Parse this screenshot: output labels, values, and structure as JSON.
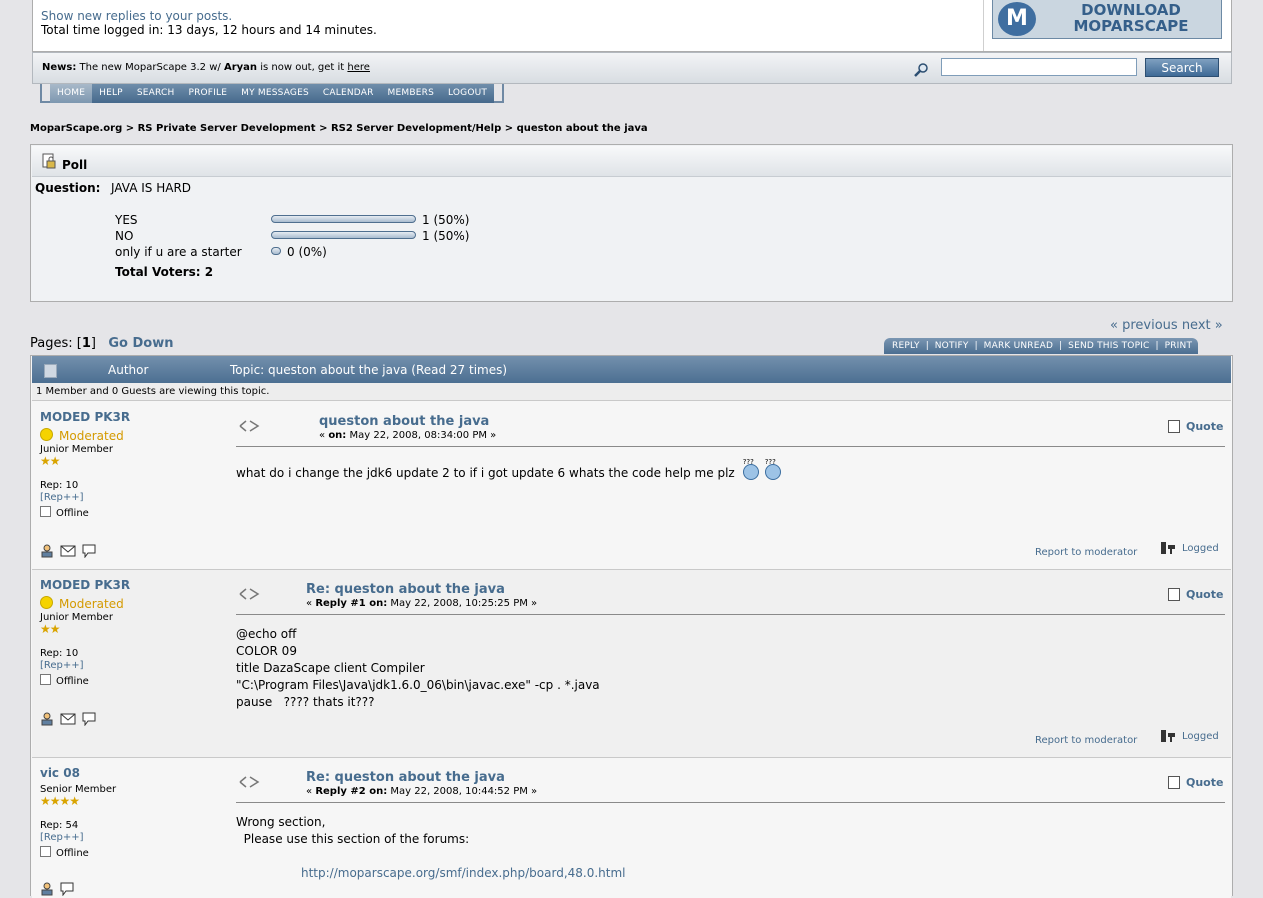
{
  "header": {
    "link_show_new_replies": "Show new replies to your posts.",
    "time_logged": "Total time logged in: 13 days, 12 hours and 14 minutes.",
    "banner_logo": "M",
    "banner_line1": "DOWNLOAD",
    "banner_line2": "MOPARSCAPE"
  },
  "news": {
    "label": "News:",
    "text_before": "The new MoparScape 3.2 w/",
    "bold": "Aryan",
    "text_after": "is now out, get it",
    "link": "here"
  },
  "search": {
    "value": "",
    "button": "Search"
  },
  "nav": [
    "HOME",
    "HELP",
    "SEARCH",
    "PROFILE",
    "MY MESSAGES",
    "CALENDAR",
    "MEMBERS",
    "LOGOUT"
  ],
  "breadcrumb": {
    "items": [
      "MoparScape.org",
      "RS Private Server Development",
      "RS2 Server Development/Help",
      "queston about the java"
    ],
    "sep": ">"
  },
  "poll": {
    "title": "Poll",
    "question_label": "Question:",
    "question": "JAVA IS HARD",
    "options": [
      {
        "label": "YES",
        "votes_text": "1 (50%)",
        "percent": 50
      },
      {
        "label": "NO",
        "votes_text": "1 (50%)",
        "percent": 50
      },
      {
        "label": "only if u are a starter",
        "votes_text": "0 (0%)",
        "percent": 0
      }
    ],
    "total": "Total Voters: 2"
  },
  "pagenav": {
    "prev": "« previous",
    "next": "next »"
  },
  "pages": {
    "label": "Pages: [",
    "current": "1",
    "close": "]",
    "go_down": "Go Down"
  },
  "topic_buttons": [
    "REPLY",
    "NOTIFY",
    "MARK UNREAD",
    "SEND THIS TOPIC",
    "PRINT"
  ],
  "topic": {
    "author_header": "Author",
    "title_header": "Topic: queston about the java  (Read 27 times)",
    "viewing": "1 Member and 0 Guests are viewing this topic."
  },
  "posts": [
    {
      "author": "MODED PK3R",
      "status": "Moderated",
      "rank": "Junior Member",
      "stars": "★★",
      "rep": "Rep: 10",
      "rep_plus": "[Rep++]",
      "online": "Offline",
      "title": "queston about the java",
      "date_prefix": "«",
      "date_label": "on:",
      "date": "May 22, 2008, 08:34:00 PM »",
      "quote": "Quote",
      "body": "what do i change the jdk6 update 2 to if i got update 6 whats the code help me plz",
      "smiley_label": "???",
      "report": "Report to moderator",
      "logged": "Logged"
    },
    {
      "author": "MODED PK3R",
      "status": "Moderated",
      "rank": "Junior Member",
      "stars": "★★",
      "rep": "Rep: 10",
      "rep_plus": "[Rep++]",
      "online": "Offline",
      "title": "Re: queston about the java",
      "date_prefix": "«",
      "date_label": "Reply #1 on:",
      "date": "May 22, 2008, 10:25:25 PM »",
      "quote": "Quote",
      "body": "@echo off\nCOLOR 09\ntitle DazaScape client Compiler\n\"C:\\Program Files\\Java\\jdk1.6.0_06\\bin\\javac.exe\" -cp . *.java\npause   ???? thats it???",
      "report": "Report to moderator",
      "logged": "Logged"
    },
    {
      "author": "vic 08",
      "rank": "Senior Member",
      "stars": "★★★★",
      "rep": "Rep: 54",
      "rep_plus": "[Rep++]",
      "online": "Offline",
      "title": "Re: queston about the java",
      "date_prefix": "«",
      "date_label": "Reply #2 on:",
      "date": "May 22, 2008, 10:44:52 PM »",
      "quote": "Quote",
      "body": "Wrong section,\n  Please use this section of the forums:",
      "link": "http://moparscape.org/smf/index.php/board,48.0.html"
    }
  ]
}
